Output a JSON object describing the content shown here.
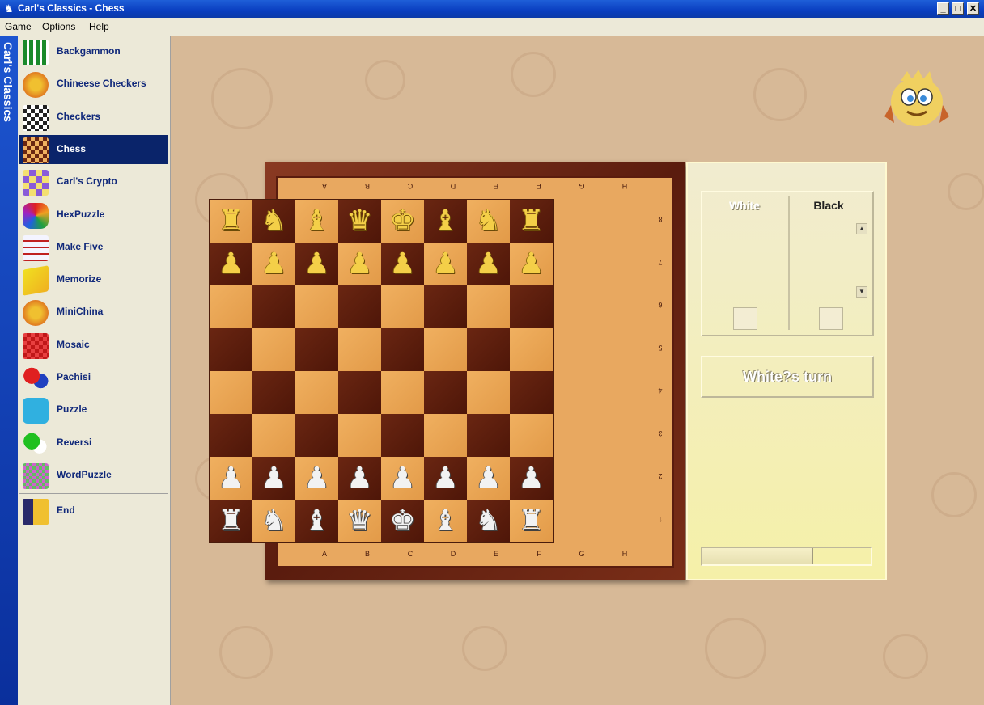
{
  "window": {
    "title": "Carl's Classics - Chess",
    "minimize": "_",
    "maximize": "□",
    "close": "✕"
  },
  "menu": [
    {
      "label": "Game"
    },
    {
      "label": "Options"
    },
    {
      "label": "Help"
    }
  ],
  "vertical_title": "Carl's Classics",
  "games": [
    {
      "label": "Backgammon",
      "icon": "backgammon-icon"
    },
    {
      "label": "Chineese Checkers",
      "icon": "chinese-checkers-icon"
    },
    {
      "label": "Checkers",
      "icon": "checkers-icon"
    },
    {
      "label": "Chess",
      "icon": "chess-icon",
      "selected": true
    },
    {
      "label": "Carl's Crypto",
      "icon": "crypto-icon"
    },
    {
      "label": "HexPuzzle",
      "icon": "hexpuzzle-icon"
    },
    {
      "label": "Make Five",
      "icon": "make-five-icon"
    },
    {
      "label": "Memorize",
      "icon": "memorize-icon"
    },
    {
      "label": "MiniChina",
      "icon": "minichina-icon"
    },
    {
      "label": "Mosaic",
      "icon": "mosaic-icon"
    },
    {
      "label": "Pachisi",
      "icon": "pachisi-icon"
    },
    {
      "label": "Puzzle",
      "icon": "puzzle-icon"
    },
    {
      "label": "Reversi",
      "icon": "reversi-icon"
    },
    {
      "label": "WordPuzzle",
      "icon": "wordpuzzle-icon"
    }
  ],
  "end_item": {
    "label": "End",
    "icon": "exit-door-icon"
  },
  "board": {
    "files_bottom": [
      "A",
      "B",
      "C",
      "D",
      "E",
      "F",
      "G",
      "H"
    ],
    "files_top": [
      "A",
      "B",
      "C",
      "D",
      "E",
      "F",
      "G",
      "H"
    ],
    "ranks": [
      "8",
      "7",
      "6",
      "5",
      "4",
      "3",
      "2",
      "1"
    ],
    "rows": [
      [
        "♜",
        "♞",
        "♝",
        "♛",
        "♚",
        "♝",
        "♞",
        "♜"
      ],
      [
        "♟",
        "♟",
        "♟",
        "♟",
        "♟",
        "♟",
        "♟",
        "♟"
      ],
      [
        "",
        "",
        "",
        "",
        "",
        "",
        "",
        ""
      ],
      [
        "",
        "",
        "",
        "",
        "",
        "",
        "",
        ""
      ],
      [
        "",
        "",
        "",
        "",
        "",
        "",
        "",
        ""
      ],
      [
        "",
        "",
        "",
        "",
        "",
        "",
        "",
        ""
      ],
      [
        "♟",
        "♟",
        "♟",
        "♟",
        "♟",
        "♟",
        "♟",
        "♟"
      ],
      [
        "♜",
        "♞",
        "♝",
        "♛",
        "♚",
        "♝",
        "♞",
        "♜"
      ]
    ]
  },
  "panel": {
    "white_header": "White",
    "black_header": "Black",
    "turn_label": "White?s turn",
    "progress": 0.65
  },
  "colors": {
    "top_pieces": "#f4cf48",
    "bottom_pieces": "#f2f2f2",
    "selected_bg": "#0a246a",
    "table_bg": "#d7b997"
  }
}
